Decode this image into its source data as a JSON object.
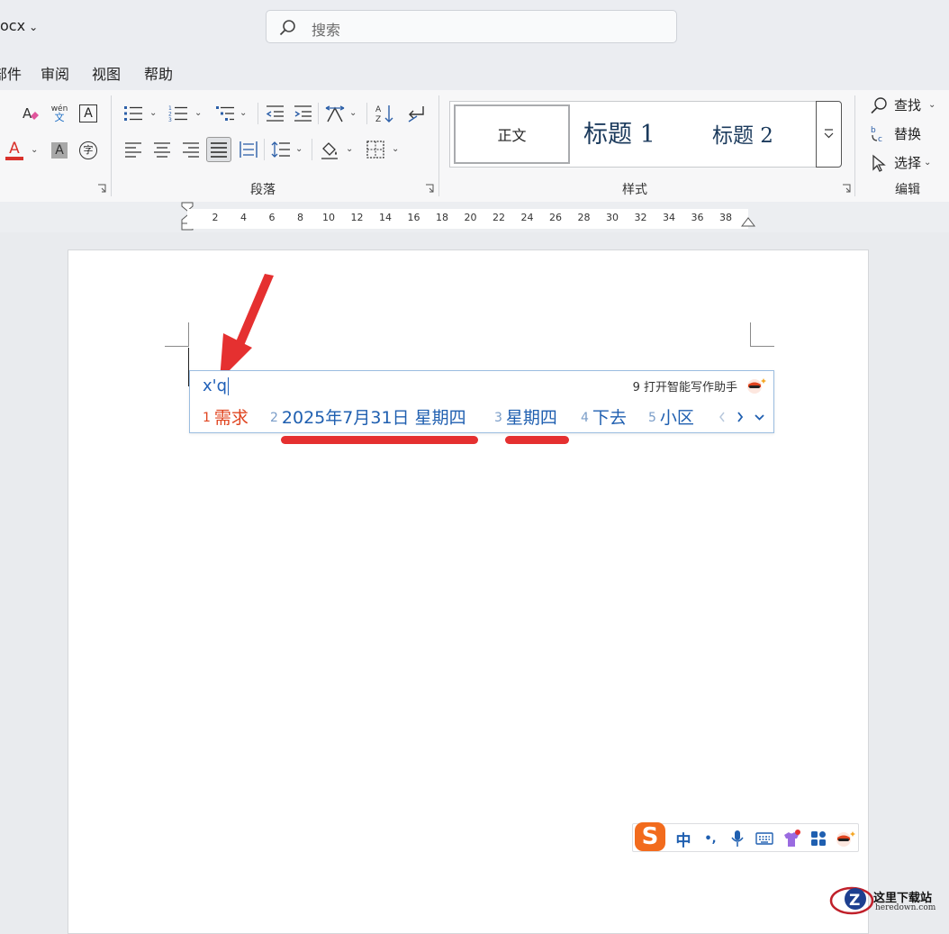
{
  "titlebar": {
    "doc_name": "ocx",
    "search_placeholder": "搜索"
  },
  "menu": {
    "tabs": [
      "部件",
      "审阅",
      "视图",
      "帮助"
    ]
  },
  "ribbon": {
    "paragraph_label": "段落",
    "styles_label": "样式",
    "editing_label": "编辑",
    "styles": {
      "normal": "正文",
      "heading1": "标题 1",
      "heading2": "标题 2"
    },
    "phonetic_top": "wén",
    "phonetic_bottom": "文",
    "font_color": "#d9312b",
    "edit": {
      "find": "查找",
      "replace": "替换",
      "select": "选择"
    }
  },
  "ruler": {
    "ticks": [
      "2",
      "4",
      "6",
      "8",
      "10",
      "12",
      "14",
      "16",
      "18",
      "20",
      "22",
      "24",
      "26",
      "28",
      "30",
      "32",
      "34",
      "36",
      "38"
    ]
  },
  "ime": {
    "pinyin": "x'q",
    "ai_hint": "9 打开智能写作助手",
    "candidates": [
      {
        "num": "1",
        "text": "需求",
        "selected": true
      },
      {
        "num": "2",
        "text": "2025年7月31日 星期四",
        "selected": false
      },
      {
        "num": "3",
        "text": "星期四",
        "selected": false
      },
      {
        "num": "4",
        "text": "下去",
        "selected": false
      },
      {
        "num": "5",
        "text": "小区",
        "selected": false
      }
    ],
    "accent_color": "#2060b8",
    "selected_color": "#e0441f"
  },
  "annotation": {
    "color": "#e53030"
  },
  "ime_toolbar": {
    "logo": "S",
    "mode": "中",
    "punct": "•,",
    "brand_color": "#f26b1d"
  },
  "watermark": {
    "text": "这里下载站",
    "sub": "heredown.com"
  }
}
